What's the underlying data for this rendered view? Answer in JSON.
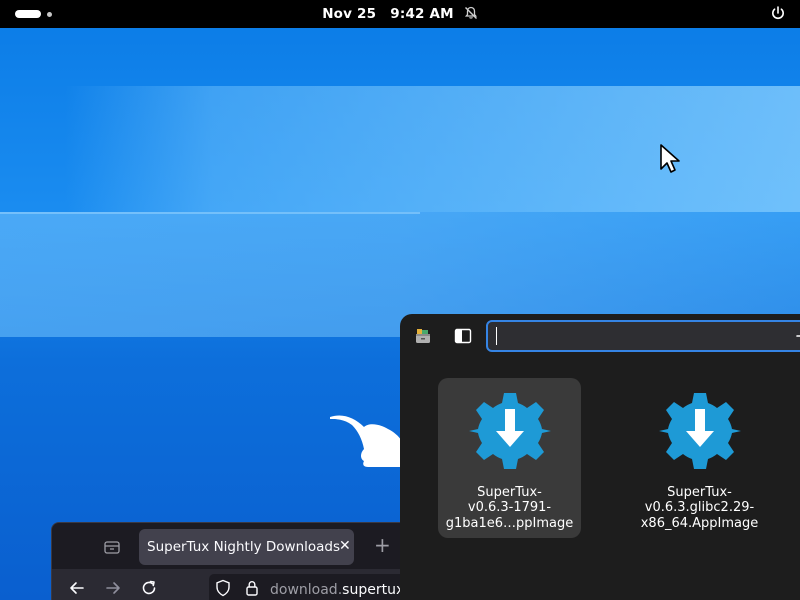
{
  "topbar": {
    "date": "Nov 25",
    "time": "9:42 AM",
    "icons": [
      "workspace-indicator",
      "notifications-muted-icon",
      "power-icon"
    ]
  },
  "desktop": {
    "wallpaper": "blue-gradient-with-mouse-silhouette",
    "colors": {
      "primary": "#0a7be6",
      "accent": "#3584e4"
    }
  },
  "search_panel": {
    "search": {
      "value": "",
      "placeholder": ""
    },
    "header_icons": [
      "file-cabinet-icon",
      "sidebar-toggle-icon"
    ],
    "results": [
      {
        "label": "SuperTux-v0.6.3-1791-g1ba1e6…ppImage",
        "lines": [
          "SuperTux-",
          "v0.6.3-1791-",
          "g1ba1e6…ppImage"
        ],
        "icon": "download-gear-icon",
        "selected": true
      },
      {
        "label": "SuperTux-v0.6.3.glibc2.29-x86_64.AppImage",
        "lines": [
          "SuperTux-",
          "v0.6.3.glibc2.29-",
          "x86_64.AppImage"
        ],
        "icon": "download-gear-icon",
        "selected": false
      }
    ]
  },
  "browser": {
    "tab_title": "SuperTux Nightly Downloads",
    "url_dim": "download.",
    "url_host": "supertux"
  }
}
